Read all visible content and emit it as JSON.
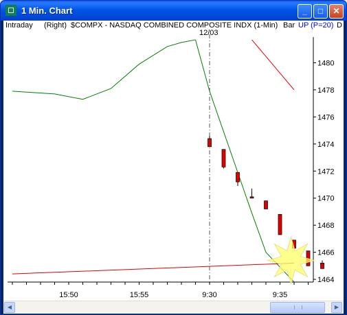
{
  "window": {
    "title": "1 Min. Chart",
    "minimize": "_",
    "maximize": "□",
    "close": "✕"
  },
  "infobar": {
    "mode": "Intraday",
    "scale": "(Right)",
    "symbol_desc": "$COMPX - NASDAQ COMBINED COMPOSITE INDX (1-Min)",
    "chart_type": "Bar",
    "indicator": "UP (P=20)",
    "overflow": "D"
  },
  "session_break_label": "12/03",
  "colors": {
    "green_line": "#008000",
    "red_line": "#e00000",
    "candle": "#e00000",
    "indicator": "#0000ff"
  },
  "chart_data": {
    "type": "candlestick",
    "x_tick_labels": [
      "15:50",
      "15:55",
      "9:30",
      "9:35"
    ],
    "y_tick_labels": [
      "1480",
      "1478",
      "1476",
      "1474",
      "1472",
      "1470",
      "1468",
      "1466",
      "1464"
    ],
    "ylim": [
      1463.8,
      1481.9
    ],
    "session_break_index": 14,
    "candles": [
      {
        "t": "9:30",
        "o": 1474.4,
        "h": 1474.6,
        "l": 1473.8,
        "c": 1473.8
      },
      {
        "t": "9:31",
        "o": 1473.6,
        "h": 1473.6,
        "l": 1472.2,
        "c": 1472.3
      },
      {
        "t": "9:32",
        "o": 1471.9,
        "h": 1471.9,
        "l": 1470.9,
        "c": 1471.2
      },
      {
        "t": "9:33",
        "o": 1470.1,
        "h": 1470.7,
        "l": 1470.0,
        "c": 1470.0
      },
      {
        "t": "9:34",
        "o": 1469.8,
        "h": 1469.8,
        "l": 1469.2,
        "c": 1469.2
      },
      {
        "t": "9:35",
        "o": 1468.8,
        "h": 1468.8,
        "l": 1467.3,
        "c": 1467.3
      },
      {
        "t": "9:36",
        "o": 1466.9,
        "h": 1466.9,
        "l": 1466.3,
        "c": 1466.3
      },
      {
        "t": "9:37",
        "o": 1466.1,
        "h": 1466.1,
        "l": 1465.0,
        "c": 1465.0
      },
      {
        "t": "9:38",
        "o": 1465.2,
        "h": 1465.4,
        "l": 1465.1,
        "c": 1465.1
      }
    ],
    "series": [
      {
        "name": "green",
        "x": [
          0,
          3,
          5,
          7,
          9,
          11,
          12,
          13
        ],
        "y": [
          1477.9,
          1477.7,
          1477.3,
          1478.1,
          1479.9,
          1481.2,
          1481.5,
          1481.7
        ]
      },
      {
        "name": "green-2",
        "x": [
          13,
          14,
          15,
          16,
          17,
          18,
          20
        ],
        "y": [
          1481.7,
          1477.9,
          1474.9,
          1471.9,
          1468.9,
          1466.0,
          1463.8
        ]
      },
      {
        "name": "red",
        "x": [
          0,
          20
        ],
        "y": [
          1464.4,
          1465.2
        ]
      },
      {
        "name": "red-2",
        "x": [
          17,
          20
        ],
        "y": [
          1481.7,
          1478.0
        ]
      }
    ]
  },
  "scrollbar": {
    "left_arrow": "◀",
    "right_arrow": "▶"
  }
}
